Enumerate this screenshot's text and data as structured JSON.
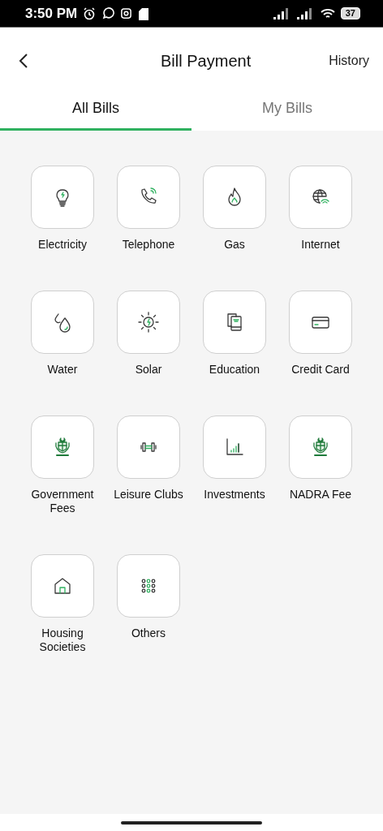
{
  "status_bar": {
    "time": "3:50 PM",
    "battery": "37"
  },
  "header": {
    "title": "Bill Payment",
    "action": "History"
  },
  "tabs": [
    {
      "label": "All Bills",
      "selected": true
    },
    {
      "label": "My Bills",
      "selected": false
    }
  ],
  "categories": [
    {
      "label": "Electricity"
    },
    {
      "label": "Telephone"
    },
    {
      "label": "Gas"
    },
    {
      "label": "Internet"
    },
    {
      "label": "Water"
    },
    {
      "label": "Solar"
    },
    {
      "label": "Education"
    },
    {
      "label": "Credit Card"
    },
    {
      "label": "Government Fees"
    },
    {
      "label": "Leisure Clubs"
    },
    {
      "label": "Investments"
    },
    {
      "label": "NADRA Fee"
    },
    {
      "label": "Housing Societies"
    },
    {
      "label": "Others"
    }
  ]
}
